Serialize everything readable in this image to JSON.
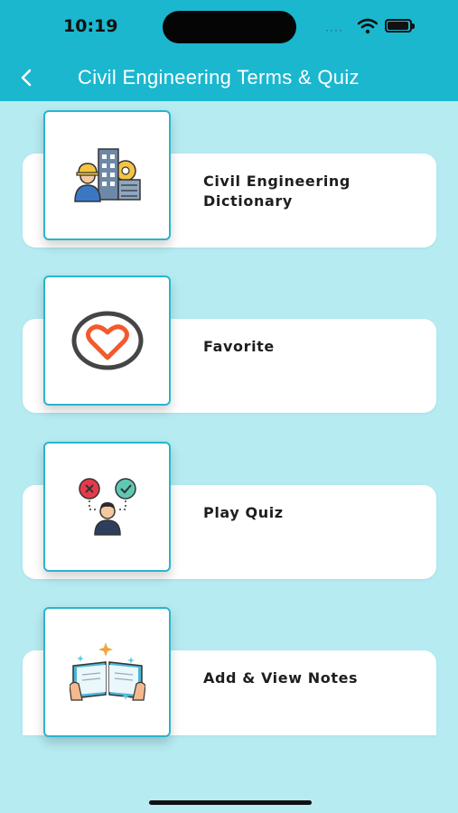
{
  "status_bar": {
    "time": "10:19",
    "signal": "····"
  },
  "nav": {
    "title": "Civil Engineering Terms & Quiz"
  },
  "menu": {
    "items": [
      {
        "label": "Civil Engineering Dictionary",
        "icon": "engineer-building-icon"
      },
      {
        "label": "Favorite",
        "icon": "heart-icon"
      },
      {
        "label": "Play Quiz",
        "icon": "quiz-person-icon"
      },
      {
        "label": "Add & View Notes",
        "icon": "open-book-icon"
      }
    ]
  },
  "colors": {
    "header": "#1ab7cf",
    "background": "#b6ebf2",
    "card": "#ffffff",
    "icon_border": "#2ab5cc",
    "heart": "#f25a2c"
  }
}
